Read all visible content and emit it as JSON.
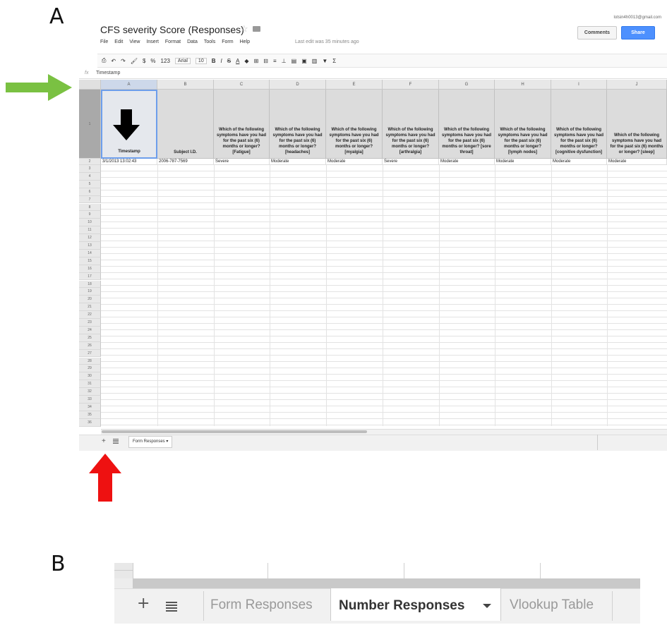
{
  "labels": {
    "panel_a": "A",
    "panel_b": "B"
  },
  "app": {
    "doc_title": "CFS severity Score (Responses)",
    "account": "lotsin4h0013@gmail.com",
    "comments_label": "Comments",
    "share_label": "Share",
    "last_edit": "Last edit was 35 minutes ago",
    "menu": [
      "File",
      "Edit",
      "View",
      "Insert",
      "Format",
      "Data",
      "Tools",
      "Form",
      "Help"
    ],
    "toolbar": {
      "currency": "$",
      "percent": "%",
      "number_format": "123",
      "font": "Arial",
      "font_size": "10",
      "bold": "B",
      "italic": "I",
      "strike": "S",
      "text_color": "A",
      "sum": "Σ"
    },
    "formula_bar": {
      "fx": "fx",
      "value": "Timestamp"
    }
  },
  "grid": {
    "columns": [
      "A",
      "B",
      "C",
      "D",
      "E",
      "F",
      "G",
      "H",
      "I",
      "J"
    ],
    "headers": [
      "Timestamp",
      "Subject I.D.",
      "Which of the following symptoms have you had for the past six (6) months or longer? [Fatigue]",
      "Which of the following symptoms have you had for the past six (6) months or longer? [headaches]",
      "Which of the following symptoms have you had for the past six (6) months or longer? [myalgia]",
      "Which of the following symptoms have you had for the past six (6) months or longer? [arthralgia]",
      "Which of the following symptoms have you had for the past six (6) months or longer? [sore throat]",
      "Which of the following symptoms have you had for the past six (6) months or longer? [lymph nodes]",
      "Which of the following symptoms have you had for the past six (6) months or longer? [cognitive dysfunction]",
      "Which of the following symptoms have you had for the past six (6) months or longer? [sleep]"
    ],
    "row2": [
      "3/1/2013 13:02:43",
      "2006-787-7569",
      "Severe",
      "Moderate",
      "Moderate",
      "Severe",
      "Moderate",
      "Moderate",
      "Moderate",
      "Moderate"
    ],
    "row_numbers": [
      "1",
      "2",
      "3",
      "4",
      "5",
      "6",
      "7",
      "8",
      "9",
      "10",
      "11",
      "12",
      "13",
      "14",
      "15",
      "16",
      "17",
      "18",
      "19",
      "20",
      "21",
      "22",
      "23",
      "24",
      "25",
      "26",
      "27",
      "28",
      "29",
      "30",
      "31",
      "32",
      "33",
      "34",
      "35",
      "36"
    ]
  },
  "sheets_a": {
    "add": "+",
    "tab": "Form Responses ▾"
  },
  "sheets_b": {
    "add": "+",
    "tabs": [
      "Form Responses",
      "Number Responses",
      "Vlookup Table"
    ],
    "active": "Number Responses"
  },
  "colors": {
    "green_arrow": "#7ac142",
    "red_arrow": "#ee1111",
    "share_blue": "#4d90fe",
    "selection_blue": "#6d9eeb"
  }
}
